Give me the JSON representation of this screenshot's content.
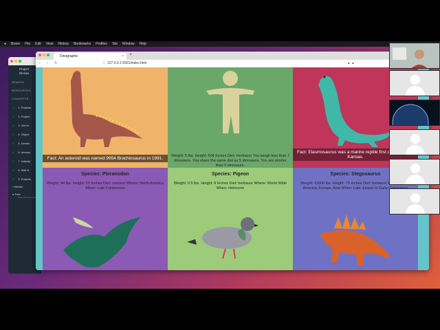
{
  "os_menubar": {
    "items": [
      "Brave",
      "File",
      "Edit",
      "View",
      "History",
      "Bookmarks",
      "Profiles",
      "Tab",
      "Window",
      "Help"
    ]
  },
  "side_app": {
    "header": "Project\nDinosa",
    "sections": [
      "SEARCH",
      "RESOURCES",
      "CONCEPTS"
    ],
    "items": [
      "1. Projects",
      "2. Project",
      "3. Get th",
      "4. Object",
      "5. Develo",
      "6. Version",
      "7. Udacity",
      "8. Skill N",
      "9. Projects"
    ],
    "footer": [
      "Mentor",
      "Peer"
    ],
    "footer_sub": "Chat with peers and alumni"
  },
  "browser": {
    "tab_title": "Dinographic",
    "tab_close": "×",
    "new_tab": "+",
    "nav_buttons": "‹ › ↻",
    "url": "127.0.0.1:5501/index.html"
  },
  "tiles": [
    {
      "fact": "Fact: An asteroid was named 9954 Brachiosaurus in 1991.",
      "color": "#f0b36a"
    },
    {
      "info": "Weight: 5 lbs. Height: 604 Inches Diet: Herbavor You weigh less than 7 dinosaurs. You share the same diet as 5 dinosaurs. You are shorter than 0 dinosaurs.",
      "color": "#6aa86a"
    },
    {
      "fact": "Fact: Elasmosaurus was a marine reptile first discovered in Kansas.",
      "color": "#c0355a"
    },
    {
      "species": "Species: Pteranodon",
      "info": "Weight: 44 lbs. Height: 20 Inches Diet: carnivor Where: North America When: Late Cretaceous",
      "color": "#8b5ab5"
    },
    {
      "species": "Species: Pigeon",
      "info": "Weight: 0.5 lbs. Height: 9 Inches Diet: herbavor Where: World Wide When: Holocene",
      "color": "#9ccb7a"
    },
    {
      "species": "Species: Stegosaurus",
      "info": "Weight: 11600 lbs. Height: 79 Inches Diet: herbavor Where: North America, Europe, Asia When: Late Jurasic to Early Cretaceous",
      "color": "#6f72c4"
    }
  ],
  "colors": {
    "desktop_gradient_start": "#3b1a5c",
    "desktop_gradient_end": "#e0603a",
    "content_bg": "#63c4c9"
  },
  "participants": [
    "camera-feed",
    "avatar",
    "video-earth",
    "avatar",
    "avatar",
    "avatar"
  ]
}
